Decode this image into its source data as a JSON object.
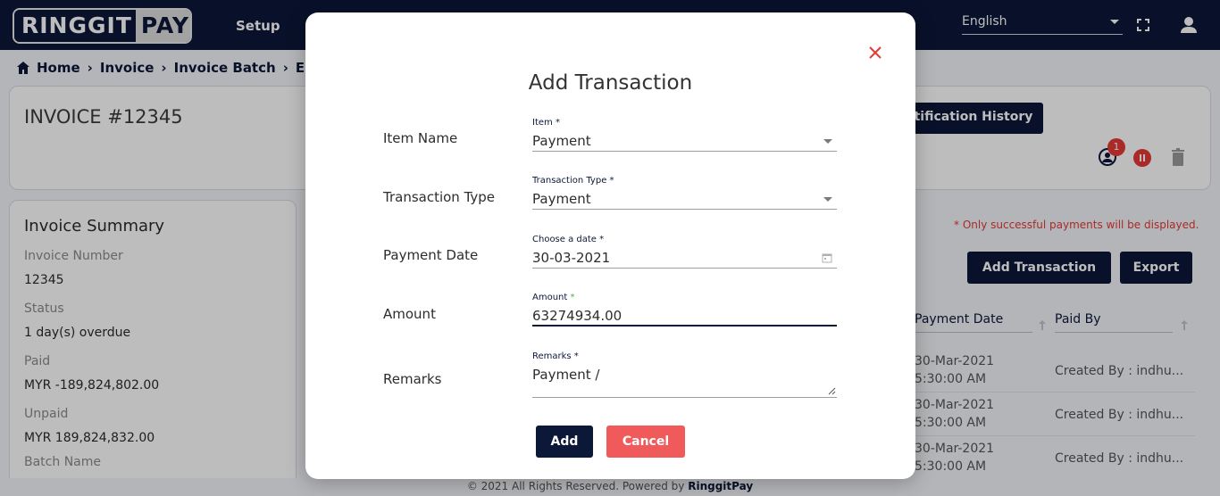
{
  "topnav": {
    "logo_part1": "RINGGIT",
    "logo_part2": "PAY",
    "setup_label": "Setup",
    "language": "English"
  },
  "breadcrumb": [
    "Home",
    "Invoice",
    "Invoice Batch",
    "E"
  ],
  "invoice": {
    "title": "INVOICE #12345",
    "notification_history_label": "otification History",
    "notification_count": "1"
  },
  "summary": {
    "title": "Invoice Summary",
    "invoice_number_label": "Invoice Number",
    "invoice_number": "12345",
    "status_label": "Status",
    "status": "1 day(s) overdue",
    "paid_label": "Paid",
    "paid": "MYR -189,824,802.00",
    "unpaid_label": "Unpaid",
    "unpaid": "MYR 189,824,832.00",
    "batch_label": "Batch Name"
  },
  "transactions": {
    "note": "* Only successful payments will be displayed.",
    "add_label": "Add Transaction",
    "export_label": "Export",
    "columns": [
      "Payment Date",
      "Paid By"
    ],
    "rows": [
      {
        "date_line1": "30-Mar-2021",
        "date_line2": "5:30:00 AM",
        "paid_by": "Created By : indhu..."
      },
      {
        "date_line1": "30-Mar-2021",
        "date_line2": "5:30:00 AM",
        "paid_by": "Created By : indhu..."
      },
      {
        "date_line1": "30-Mar-2021",
        "date_line2": "5:30:00 AM",
        "paid_by": "Created By : indhu..."
      }
    ]
  },
  "footer": {
    "text": "© 2021 All Rights Reserved. Powered by",
    "brand": "RinggitPay"
  },
  "modal": {
    "title": "Add Transaction",
    "fields": {
      "item": {
        "row_label": "Item Name",
        "label": "Item *",
        "value": "Payment"
      },
      "transaction_type": {
        "row_label": "Transaction Type",
        "label": "Transaction Type *",
        "value": "Payment"
      },
      "payment_date": {
        "row_label": "Payment Date",
        "label": "Choose a date *",
        "value": "30-03-2021"
      },
      "amount": {
        "row_label": "Amount",
        "label": "Amount ",
        "required_mark": "*",
        "value": "63274934.00"
      },
      "remarks": {
        "row_label": "Remarks",
        "label": "Remarks *",
        "value": "Payment /"
      }
    },
    "add_label": "Add",
    "cancel_label": "Cancel"
  },
  "colors": {
    "navy": "#0b1838",
    "danger": "#e53935",
    "cancel": "#f15a5a"
  }
}
